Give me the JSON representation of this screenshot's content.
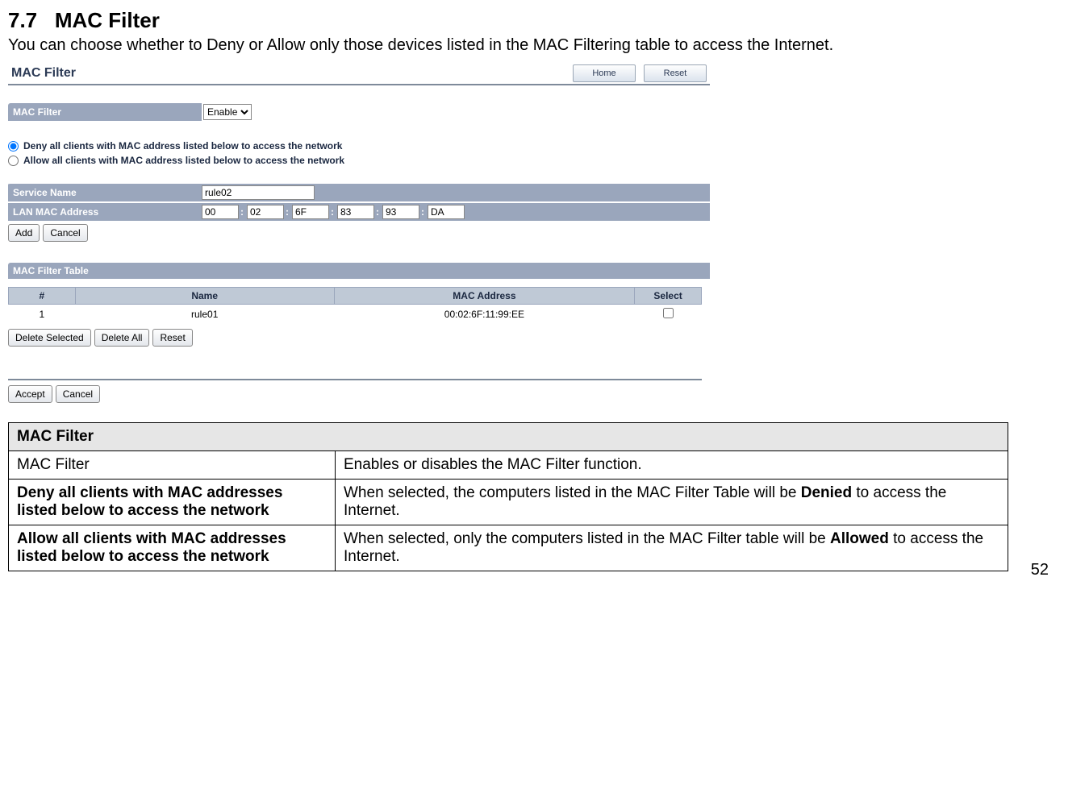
{
  "section": {
    "number": "7.7",
    "title": "MAC Filter",
    "intro": "You can choose whether to Deny or Allow only those devices listed in the MAC Filtering table to access the Internet."
  },
  "screenshot": {
    "title": "MAC Filter",
    "top_buttons": {
      "home": "Home",
      "reset": "Reset"
    },
    "mac_filter_label": "MAC Filter",
    "mac_filter_value": "Enable",
    "radio_deny": "Deny all clients with MAC address listed below to access the network",
    "radio_allow": "Allow all clients with MAC address listed below to access the network",
    "service_name_label": "Service Name",
    "service_name_value": "rule02",
    "lan_mac_label": "LAN MAC Address",
    "mac": [
      "00",
      "02",
      "6F",
      "83",
      "93",
      "DA"
    ],
    "btn_add": "Add",
    "btn_cancel": "Cancel",
    "table_section": "MAC Filter Table",
    "th_num": "#",
    "th_name": "Name",
    "th_mac": "MAC Address",
    "th_select": "Select",
    "row": {
      "num": "1",
      "name": "rule01",
      "mac": "00:02:6F:11:99:EE"
    },
    "btn_del_sel": "Delete Selected",
    "btn_del_all": "Delete All",
    "btn_reset2": "Reset",
    "btn_accept": "Accept",
    "btn_cancel2": "Cancel"
  },
  "desc": {
    "header": "MAC Filter",
    "r1_left": "MAC Filter",
    "r1_right": "Enables or disables the MAC Filter function.",
    "r2_left": "Deny all clients with MAC addresses listed below to access the network",
    "r2_right_a": "When selected, the computers listed in the MAC Filter Table will be ",
    "r2_right_b": "Denied",
    "r2_right_c": " to access the Internet.",
    "r3_left": "Allow all clients with MAC addresses listed below to access the network",
    "r3_right_a": "When selected, only the computers listed in the MAC Filter table will be ",
    "r3_right_b": "Allowed",
    "r3_right_c": " to access the Internet."
  },
  "page_number": "52"
}
